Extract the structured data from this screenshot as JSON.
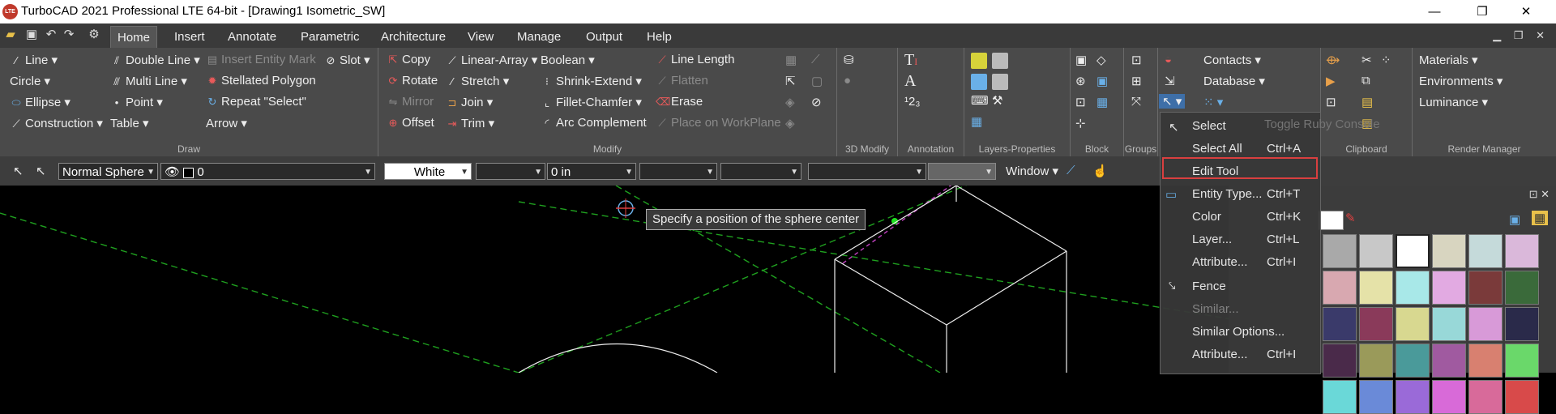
{
  "titlebar": {
    "logo_text": "LTE",
    "title": "TurboCAD 2021 Professional LTE 64-bit - [Drawing1 Isometric_SW]"
  },
  "window_controls": {
    "minimize": "—",
    "maximize": "❐",
    "close": "✕"
  },
  "menu_tabs": [
    "Home",
    "Insert",
    "Annotate",
    "Parametric",
    "Architecture",
    "View",
    "Manage",
    "Output",
    "Help"
  ],
  "ribbon": {
    "draw": {
      "label": "Draw",
      "items": [
        "Line",
        "Circle",
        "Ellipse",
        "Construction",
        "Double Line",
        "Multi Line",
        "Point",
        "Table",
        "Insert Entity Mark",
        "Stellated Polygon",
        "Repeat \"Select\"",
        "Arrow",
        "Slot"
      ]
    },
    "modify": {
      "label": "Modify",
      "items": [
        "Copy",
        "Rotate",
        "Mirror",
        "Offset",
        "Linear-Array",
        "Stretch",
        "Join",
        "Trim",
        "Boolean",
        "Shrink-Extend",
        "Fillet-Chamfer",
        "Arc Complement",
        "Line Length",
        "Flatten",
        "Erase",
        "Place on WorkPlane"
      ]
    },
    "section_labels": {
      "modify3d": "3D Modify",
      "annotation": "Annotation",
      "layers": "Layers-Properties",
      "block": "Block",
      "groups": "Groups",
      "clipboard": "Clipboard",
      "render": "Render Manager"
    },
    "db_items": [
      "Contacts",
      "Database"
    ],
    "render_items": [
      "Materials",
      "Environments",
      "Luminance"
    ]
  },
  "propbar": {
    "sphere_type": "Normal Sphere",
    "layer_value": "0",
    "color": "White",
    "thickness": "0 in",
    "window_label": "Window"
  },
  "canvas": {
    "tooltip": "Specify a position of the sphere center",
    "ghost_text": "Toggle Ruby Console"
  },
  "context_menu": {
    "items": [
      {
        "label": "Select",
        "shortcut": ""
      },
      {
        "label": "Select All",
        "shortcut": "Ctrl+A"
      },
      {
        "label": "Edit Tool",
        "shortcut": ""
      },
      {
        "label": "Entity Type...",
        "shortcut": "Ctrl+T"
      },
      {
        "label": "Color",
        "shortcut": "Ctrl+K"
      },
      {
        "label": "Layer...",
        "shortcut": "Ctrl+L"
      },
      {
        "label": "Attribute...",
        "shortcut": "Ctrl+I"
      },
      {
        "label": "Fence",
        "shortcut": ""
      },
      {
        "label": "Similar...",
        "shortcut": ""
      },
      {
        "label": "Similar Options...",
        "shortcut": ""
      },
      {
        "label": "Attribute...",
        "shortcut": "Ctrl+I"
      }
    ]
  },
  "colors": {
    "accent_highlight": "#e04040",
    "ribbon_bg": "#4a4a4a",
    "canvas_bg": "#000000",
    "grid_line": "#1fa01f"
  },
  "palette": [
    "#a9a9a9",
    "#c8c8c8",
    "#ffffff",
    "#d8d5c0",
    "#c5dada",
    "#dab8da",
    "#d8a8b0",
    "#e5e2a8",
    "#a8e8e8",
    "#e2aae2",
    "#7a3a3a",
    "#3a6a3a",
    "#3a3a6a",
    "#8a3a5a",
    "#d8d890",
    "#98d8d8",
    "#d89ad8",
    "#2a2a4a",
    "#4a2a4a",
    "#9a9a5a",
    "#4a9a9a",
    "#a05aa0",
    "#d88070",
    "#6ad86a",
    "#6ad8d8",
    "#6a8ad8",
    "#9a6ad8",
    "#d86ad8",
    "#d86a9a",
    "#d84a4a"
  ]
}
